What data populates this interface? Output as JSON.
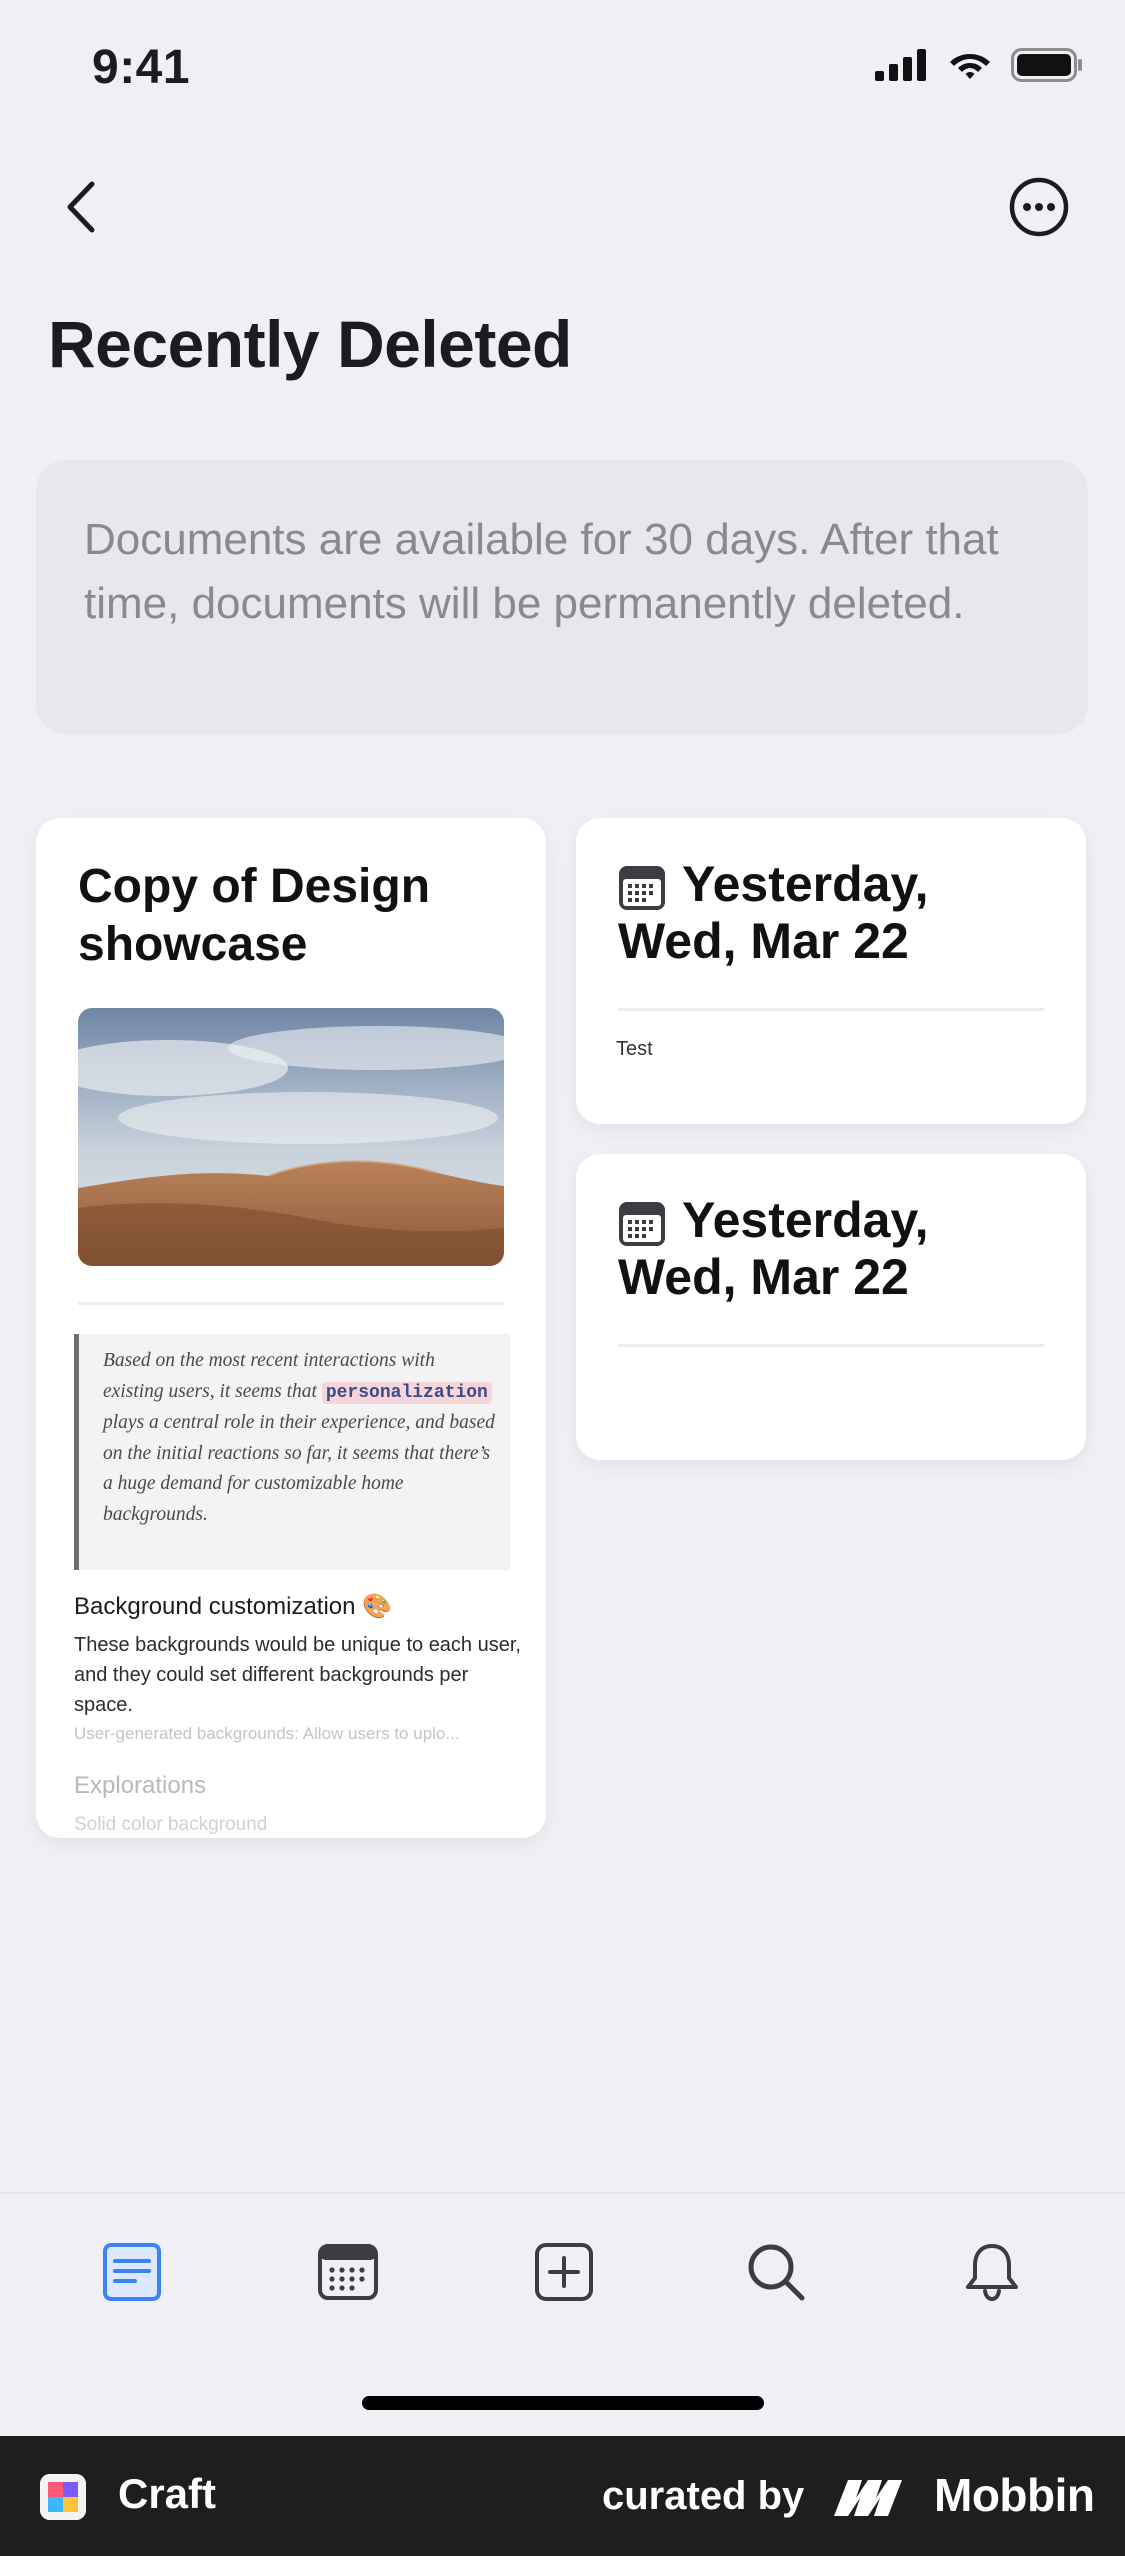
{
  "status_bar": {
    "time": "9:41"
  },
  "header": {
    "title": "Recently Deleted"
  },
  "info": {
    "message": "Documents are available for 30 days. After that time, documents will be permanently deleted."
  },
  "documents": [
    {
      "title": "Copy of Design showcase",
      "quote_before": "Based on the most recent interactions with existing users, it seems that ",
      "quote_code": "personalization",
      "quote_after": " plays a central role in their experience, and based on the initial reactions so far, it seems that there’s a huge demand for customizable home backgrounds.",
      "section_heading": "Background customization 🎨",
      "section_body": "These backgrounds would be unique to each user, and they could set different backgrounds per space.",
      "section_faded": "User-generated backgrounds: Allow users to uplo...",
      "section_heading2": "Explorations",
      "section_faded2": "Solid color background"
    },
    {
      "title": "Yesterday, Wed, Mar 22",
      "note": "Test"
    },
    {
      "title": "Yesterday, Wed, Mar 22",
      "note": ""
    }
  ],
  "tabbar": {
    "tabs": [
      {
        "icon": "documents-icon",
        "active": true
      },
      {
        "icon": "calendar-icon",
        "active": false
      },
      {
        "icon": "add-icon",
        "active": false
      },
      {
        "icon": "search-icon",
        "active": false
      },
      {
        "icon": "bell-icon",
        "active": false
      }
    ],
    "active_color": "#3b82f6",
    "inactive_color": "#3c3c43"
  },
  "footer": {
    "app_name": "Craft",
    "curated_by": "curated by",
    "brand": "Mobbin"
  }
}
